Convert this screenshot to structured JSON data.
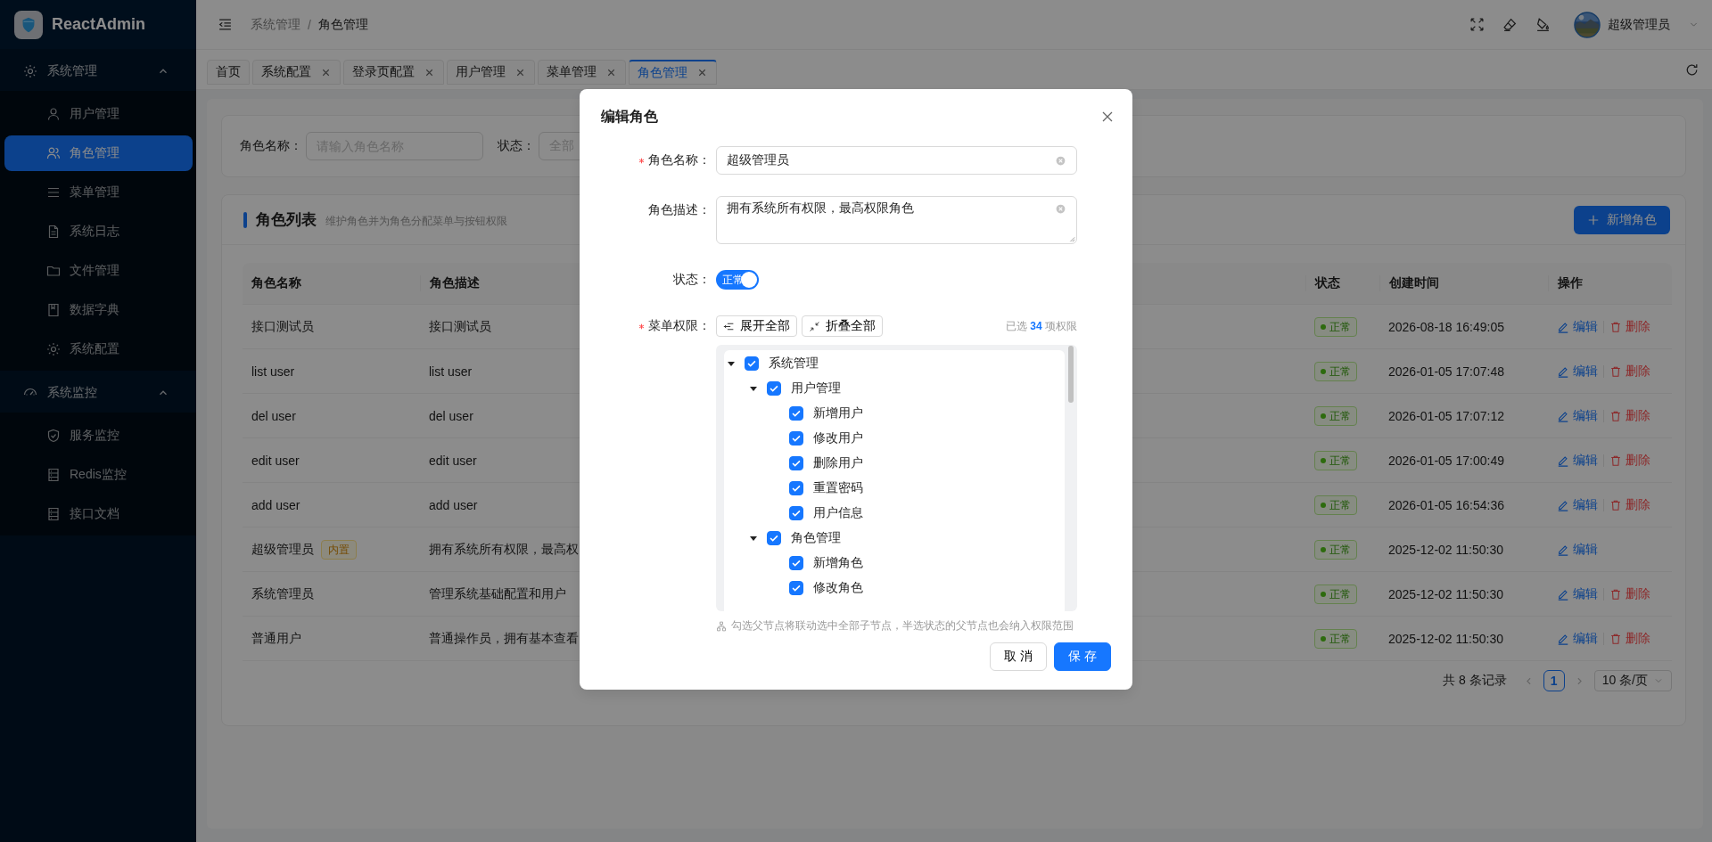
{
  "sidebar": {
    "logo_text": "ReactAdmin",
    "groups": [
      {
        "label": "系统管理",
        "expanded": true,
        "items": [
          {
            "label": "用户管理",
            "selected": false
          },
          {
            "label": "角色管理",
            "selected": true
          },
          {
            "label": "菜单管理",
            "selected": false
          },
          {
            "label": "系统日志",
            "selected": false
          },
          {
            "label": "文件管理",
            "selected": false
          },
          {
            "label": "数据字典",
            "selected": false
          },
          {
            "label": "系统配置",
            "selected": false
          }
        ]
      },
      {
        "label": "系统监控",
        "expanded": true,
        "items": [
          {
            "label": "服务监控",
            "selected": false
          },
          {
            "label": "Redis监控",
            "selected": false
          },
          {
            "label": "接口文档",
            "selected": false
          }
        ]
      }
    ]
  },
  "header": {
    "breadcrumb": [
      "系统管理",
      "角色管理"
    ],
    "breadcrumb_separator": "/",
    "user": "超级管理员"
  },
  "tabs": [
    {
      "label": "首页",
      "closable": false,
      "selected": false
    },
    {
      "label": "系统配置",
      "closable": true,
      "selected": false
    },
    {
      "label": "登录页配置",
      "closable": true,
      "selected": false
    },
    {
      "label": "用户管理",
      "closable": true,
      "selected": false
    },
    {
      "label": "菜单管理",
      "closable": true,
      "selected": false
    },
    {
      "label": "角色管理",
      "closable": true,
      "selected": true
    }
  ],
  "filter": {
    "fields": [
      {
        "kind": "input",
        "label": "角色名称：",
        "placeholder": "请输入角色名称"
      },
      {
        "kind": "select",
        "label": "状态：",
        "placeholder": "全部"
      }
    ]
  },
  "card": {
    "title": "角色列表",
    "subtitle": "维护角色并为角色分配菜单与按钮权限",
    "add_button": "新增角色"
  },
  "table": {
    "columns": [
      "角色名称",
      "角色描述",
      "状态",
      "创建时间",
      "操作"
    ],
    "rows": [
      {
        "name": "接口测试员",
        "description": "接口测试员",
        "status": "正常",
        "created": "2026-08-18 16:49:05",
        "actions": [
          {
            "kind": "edit",
            "label": "编辑"
          },
          {
            "kind": "delete",
            "label": "删除"
          }
        ]
      },
      {
        "name": "list user",
        "description": "list user",
        "status": "正常",
        "created": "2026-01-05 17:07:48",
        "actions": [
          {
            "kind": "edit",
            "label": "编辑"
          },
          {
            "kind": "delete",
            "label": "删除"
          }
        ]
      },
      {
        "name": "del user",
        "description": "del user",
        "status": "正常",
        "created": "2026-01-05 17:07:12",
        "actions": [
          {
            "kind": "edit",
            "label": "编辑"
          },
          {
            "kind": "delete",
            "label": "删除"
          }
        ]
      },
      {
        "name": "edit user",
        "description": "edit user",
        "status": "正常",
        "created": "2026-01-05 17:00:49",
        "actions": [
          {
            "kind": "edit",
            "label": "编辑"
          },
          {
            "kind": "delete",
            "label": "删除"
          }
        ]
      },
      {
        "name": "add user",
        "description": "add user",
        "status": "正常",
        "created": "2026-01-05 16:54:36",
        "actions": [
          {
            "kind": "edit",
            "label": "编辑"
          },
          {
            "kind": "delete",
            "label": "删除"
          }
        ]
      },
      {
        "name": "超级管理员",
        "tag": "内置",
        "description": "拥有系统所有权限，最高权",
        "status": "正常",
        "created": "2025-12-02 11:50:30",
        "actions": [
          {
            "kind": "edit",
            "label": "编辑"
          }
        ]
      },
      {
        "name": "系统管理员",
        "description": "管理系统基础配置和用户",
        "status": "正常",
        "created": "2025-12-02 11:50:30",
        "actions": [
          {
            "kind": "edit",
            "label": "编辑"
          },
          {
            "kind": "delete",
            "label": "删除"
          }
        ]
      },
      {
        "name": "普通用户",
        "description": "普通操作员，拥有基本查看",
        "status": "正常",
        "created": "2025-12-02 11:50:30",
        "actions": [
          {
            "kind": "edit",
            "label": "编辑"
          },
          {
            "kind": "delete",
            "label": "删除"
          }
        ]
      }
    ]
  },
  "pagination": {
    "total": "共 8 条记录",
    "pages": [
      {
        "label": "1",
        "selected": true
      }
    ],
    "page_size": "10 条/页"
  },
  "modal": {
    "title": "编辑角色",
    "fields": [
      {
        "kind": "input",
        "label": "角色名称：",
        "required": true,
        "value": "超级管理员"
      },
      {
        "kind": "textarea",
        "label": "角色描述：",
        "required": false,
        "value": "拥有系统所有权限，最高权限角色"
      },
      {
        "kind": "switch",
        "label": "状态：",
        "required": false,
        "on": true,
        "text": "正常"
      },
      {
        "kind": "tree",
        "label": "菜单权限：",
        "required": true
      }
    ],
    "tree_actions": [
      {
        "kind": "expand",
        "label": "展开全部"
      },
      {
        "kind": "collapse",
        "label": "折叠全部"
      }
    ],
    "selected_count": "已选 **34** 项权限",
    "tree": [
      {
        "label": "系统管理",
        "checked": true,
        "expanded": true,
        "children": [
          {
            "label": "用户管理",
            "checked": true,
            "expanded": true,
            "children": [
              {
                "label": "新增用户",
                "checked": true
              },
              {
                "label": "修改用户",
                "checked": true
              },
              {
                "label": "删除用户",
                "checked": true
              },
              {
                "label": "重置密码",
                "checked": true
              },
              {
                "label": "用户信息",
                "checked": true
              }
            ]
          },
          {
            "label": "角色管理",
            "checked": true,
            "expanded": true,
            "children": [
              {
                "label": "新增角色",
                "checked": true
              },
              {
                "label": "修改角色",
                "checked": true
              }
            ]
          }
        ]
      }
    ],
    "hint": "勾选父节点将联动选中全部子节点，半选状态的父节点也会纳入权限范围",
    "buttons": [
      {
        "kind": "default",
        "label": "取 消"
      },
      {
        "kind": "primary",
        "label": "保 存"
      }
    ]
  }
}
